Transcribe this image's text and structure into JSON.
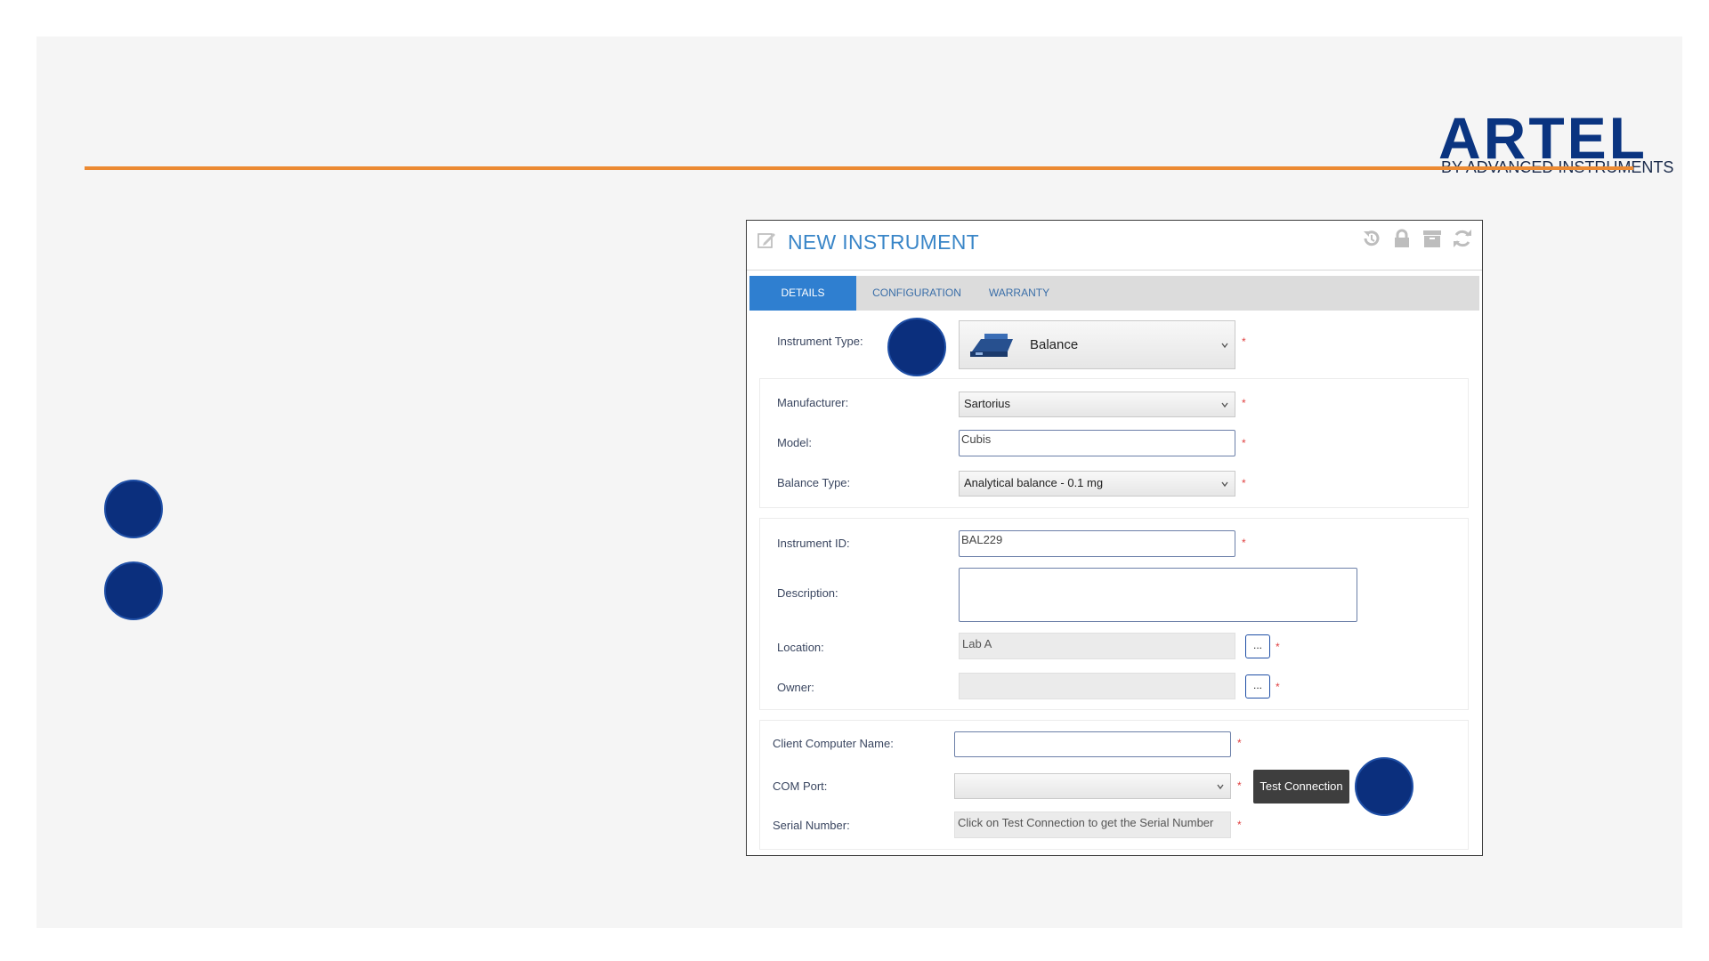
{
  "brand": {
    "name": "ARTEL",
    "tagline": "BY ADVANCED INSTRUMENTS",
    "color": "#0a3480",
    "rule_color": "#ec8a32"
  },
  "marker_color": "#0b2f7d",
  "window": {
    "title": "NEW INSTRUMENT",
    "header_icons": [
      "history-icon",
      "lock-icon",
      "archive-icon",
      "refresh-icon"
    ],
    "tabs": [
      "DETAILS",
      "CONFIGURATION",
      "WARRANTY"
    ],
    "active_tab": "DETAILS"
  },
  "form": {
    "instrument_type": {
      "label": "Instrument Type:",
      "value": "Balance",
      "icon": "balance-scale-icon"
    },
    "manufacturer": {
      "label": "Manufacturer:",
      "value": "Sartorius"
    },
    "model": {
      "label": "Model:",
      "value": "Cubis"
    },
    "balance_type": {
      "label": "Balance Type:",
      "value": "Analytical balance - 0.1 mg"
    },
    "instrument_id": {
      "label": "Instrument ID:",
      "value": "BAL229"
    },
    "description": {
      "label": "Description:",
      "value": ""
    },
    "location": {
      "label": "Location:",
      "value": "Lab A",
      "button": "..."
    },
    "owner": {
      "label": "Owner:",
      "value": "",
      "button": "..."
    },
    "client_computer": {
      "label": "Client Computer Name:",
      "value": ""
    },
    "com_port": {
      "label": "COM Port:",
      "value": ""
    },
    "serial_number": {
      "label": "Serial Number:",
      "value": "Click on Test Connection to get the Serial Number"
    },
    "required_mark": "*",
    "test_connection": "Test Connection"
  }
}
